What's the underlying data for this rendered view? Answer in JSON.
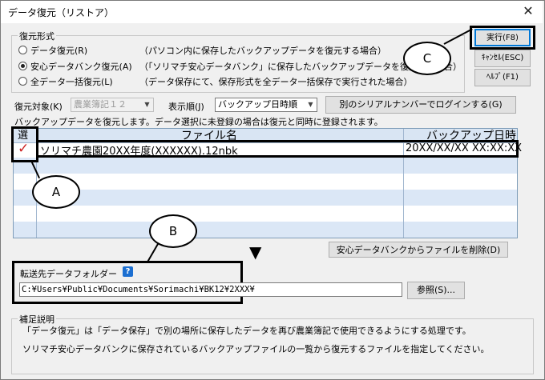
{
  "window": {
    "title": "データ復元（リストア）",
    "close_glyph": "✕"
  },
  "restore_mode": {
    "legend": "復元形式",
    "options": [
      {
        "label": "データ復元(R)",
        "desc": "（パソコン内に保存したバックアップデータを復元する場合）",
        "selected": false
      },
      {
        "label": "安心データバンク復元(A)",
        "desc": "（「ソリマチ安心データバンク」に保存したバックアップデータを復元する場合）",
        "selected": true
      },
      {
        "label": "全データ一括復元(L)",
        "desc": "（データ保存にて、保存形式を全データ一括保存で実行された場合）",
        "selected": false
      }
    ]
  },
  "buttons": {
    "execute": "実行(F8)",
    "cancel": "ｷｬﾝｾﾙ(ESC)",
    "help": "ﾍﾙﾌﾟ(F1)",
    "login_other_serial": "別のシリアルナンバーでログインする(G)",
    "delete_from_bank": "安心データバンクからファイルを削除(D)",
    "browse": "参照(S)..."
  },
  "filters": {
    "target_label": "復元対象(K)",
    "target_value": "農業簿記１２",
    "order_label": "表示順(J)",
    "order_value": "バックアップ日時順"
  },
  "instruction": "バックアップデータを復元します。データ選択に未登録の場合は復元と同時に登録されます。",
  "table": {
    "headers": {
      "select": "選",
      "filename": "ファイル名",
      "backup_time": "バックアップ日時"
    },
    "rows": [
      {
        "checked": true,
        "check_glyph": "✓",
        "filename": "ソリマチ農園20XX年度(XXXXXX).12nbk",
        "backup_time": "20XX/XX/XX XX:XX:XX"
      },
      {
        "checked": false,
        "check_glyph": "",
        "filename": "",
        "backup_time": ""
      },
      {
        "checked": false,
        "check_glyph": "",
        "filename": "",
        "backup_time": ""
      },
      {
        "checked": false,
        "check_glyph": "",
        "filename": "",
        "backup_time": ""
      },
      {
        "checked": false,
        "check_glyph": "",
        "filename": "",
        "backup_time": ""
      },
      {
        "checked": false,
        "check_glyph": "",
        "filename": "",
        "backup_time": ""
      }
    ]
  },
  "dest_folder": {
    "label": "転送先データフォルダー",
    "help_glyph": "?",
    "path": "C:¥Users¥Public¥Documents¥Sorimachi¥BK12¥2XXX¥"
  },
  "notes": {
    "legend": "補足説明",
    "lines": [
      "「データ復元」は「データ保存」で別の場所に保存したデータを再び農業簿記で使用できるようにする処理です。",
      "ソリマチ安心データバンクに保存されているバックアップファイルの一覧から復元するファイルを指定してください。"
    ]
  },
  "callouts": {
    "a": "A",
    "b": "B",
    "c": "C",
    "arrow_glyph": "▼"
  },
  "colors": {
    "checkmark": "#cc2222",
    "grid_header": "#d9e5f3",
    "grid_alt_row": "#dbe7f6",
    "help_badge": "#1c6fd1",
    "default_button_border": "#0078d7"
  }
}
